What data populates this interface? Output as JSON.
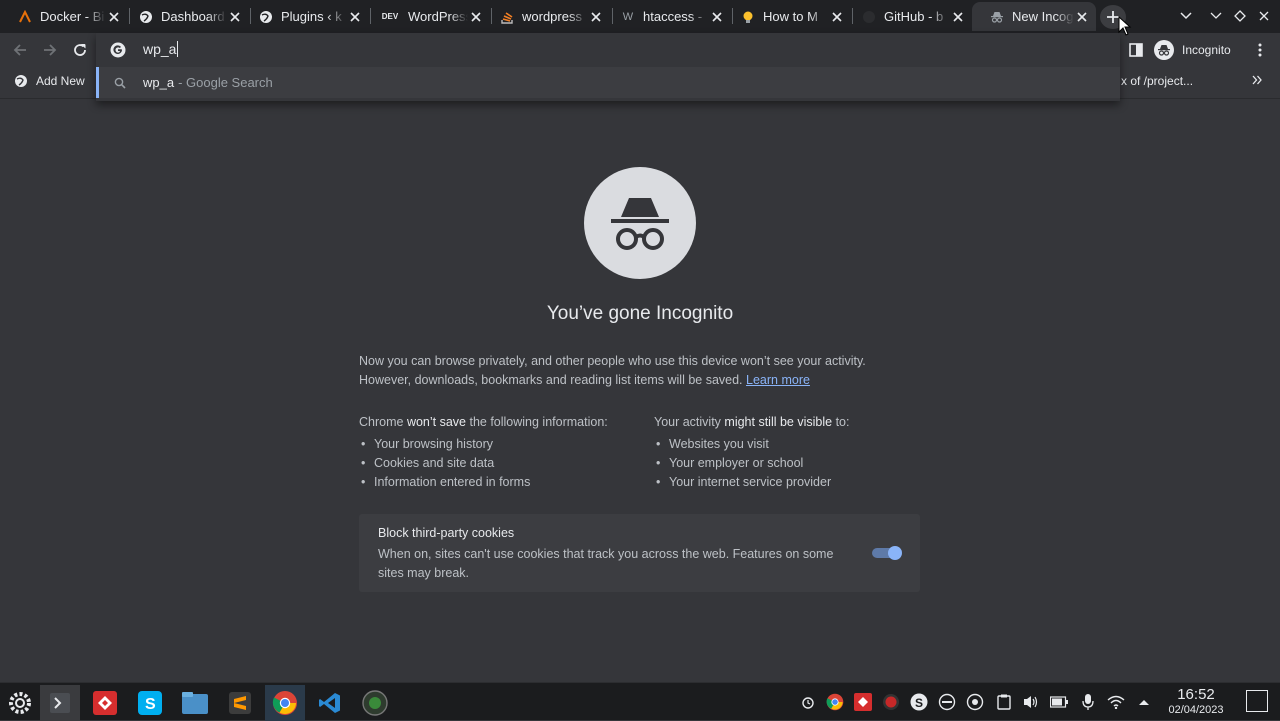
{
  "tabs": [
    {
      "title": "Docker - Bi",
      "icon": "docker-icon",
      "active": false
    },
    {
      "title": "Dashboard",
      "icon": "globe-icon",
      "active": false
    },
    {
      "title": "Plugins ‹ k",
      "icon": "globe-icon",
      "active": false
    },
    {
      "title": "WordPress",
      "icon": "dev-icon",
      "active": false
    },
    {
      "title": "wordpress",
      "icon": "stackoverflow-icon",
      "active": false
    },
    {
      "title": "htaccess -",
      "icon": "wikipedia-icon",
      "active": false
    },
    {
      "title": "How to M",
      "icon": "lightbulb-icon",
      "active": false
    },
    {
      "title": "GitHub - b",
      "icon": "github-icon",
      "active": false
    },
    {
      "title": "New Incog",
      "icon": "incognito-icon",
      "active": true
    }
  ],
  "dev_badge": "DEV",
  "omnibox": {
    "value": "wp_a",
    "suggestion_query": "wp_a",
    "suggestion_suffix": "- Google Search"
  },
  "profile": {
    "label": "Incognito"
  },
  "bookmarks": {
    "add_new": "Add New",
    "right_item": "x of /project..."
  },
  "page": {
    "heading": "You’ve gone Incognito",
    "para_line1": "Now you can browse privately, and other people who use this device won’t see your activity.",
    "para_line2": "However, downloads, bookmarks and reading list items will be saved.",
    "learn_more": "Learn more",
    "left_head_pre": "Chrome ",
    "left_head_bold": "won’t save",
    "left_head_post": " the following information:",
    "left_items": [
      "Your browsing history",
      "Cookies and site data",
      "Information entered in forms"
    ],
    "right_head_pre": "Your activity ",
    "right_head_bold": "might still be visible",
    "right_head_post": " to:",
    "right_items": [
      "Websites you visit",
      "Your employer or school",
      "Your internet service provider"
    ],
    "cookies_title": "Block third-party cookies",
    "cookies_desc": "When on, sites can't use cookies that track you across the web. Features on some sites may break.",
    "cookies_on": true
  },
  "clock": {
    "time": "16:52",
    "date": "02/04/2023"
  },
  "colors": {
    "accent": "#8ab4f8",
    "background": "#35363a",
    "tabstrip": "#202124"
  }
}
